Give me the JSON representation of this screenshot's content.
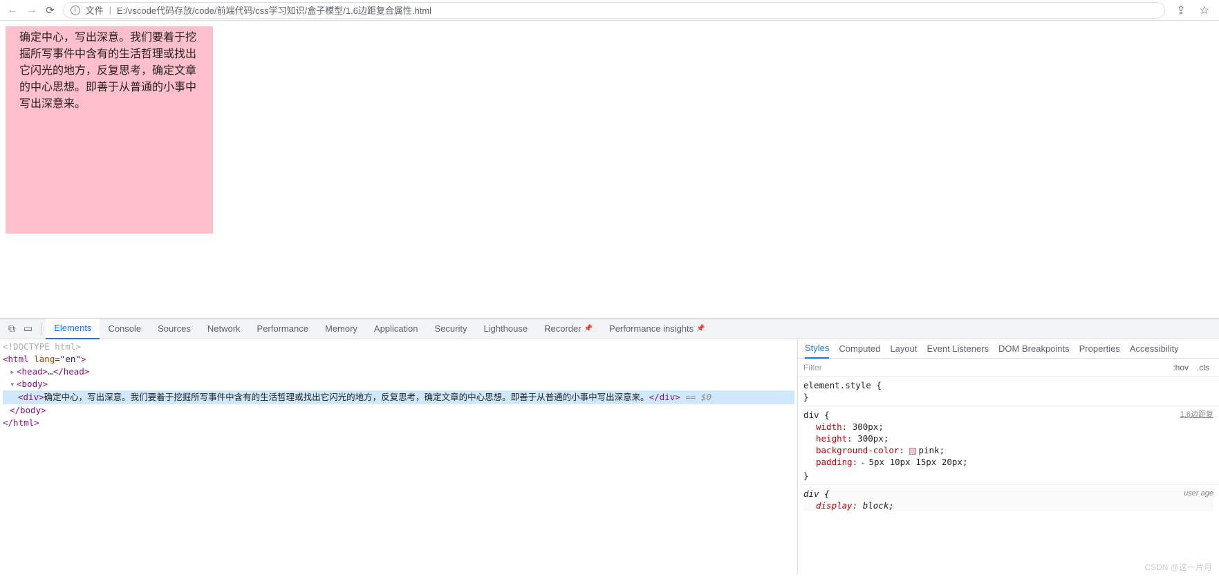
{
  "toolbar": {
    "file_label": "文件",
    "url": "E:/vscode代码存放/code/前端代码/css学习知识/盒子模型/1.6边距复合属性.html"
  },
  "page": {
    "box_text": "确定中心，写出深意。我们要着于挖掘所写事件中含有的生活哲理或找出它闪光的地方，反复思考，确定文章的中心思想。即善于从普通的小事中写出深意来。"
  },
  "devtools": {
    "tabs": [
      "Elements",
      "Console",
      "Sources",
      "Network",
      "Performance",
      "Memory",
      "Application",
      "Security",
      "Lighthouse",
      "Recorder",
      "Performance insights"
    ],
    "active_tab": "Elements"
  },
  "elements": {
    "doctype": "<!DOCTYPE html>",
    "html_open": "<html lang=\"en\">",
    "head_collapsed": "<head>…</head>",
    "body_open": "<body>",
    "div_text": "确定中心，写出深意。我们要着于挖掘所写事件中含有的生活哲理或找出它闪光的地方，反复思考，确定文章的中心思想。即善于从普通的小事中写出深意来。",
    "selected_marker": "== $0",
    "body_close": "</body>",
    "html_close": "</html>"
  },
  "styles": {
    "tabs": [
      "Styles",
      "Computed",
      "Layout",
      "Event Listeners",
      "DOM Breakpoints",
      "Properties",
      "Accessibility"
    ],
    "filter_placeholder": "Filter",
    "hov": ":hov",
    "cls": ".cls",
    "element_style": "element.style {",
    "brace_close": "}",
    "div_rule": {
      "selector": "div {",
      "source": "1.6边距复",
      "props": {
        "width": {
          "name": "width",
          "value": "300px;"
        },
        "height": {
          "name": "height",
          "value": "300px;"
        },
        "bg": {
          "name": "background-color",
          "value": "pink;"
        },
        "padding": {
          "name": "padding",
          "value": "5px 10px 15px 20px;"
        }
      }
    },
    "ua_rule": {
      "selector": "div {",
      "source": "user age",
      "display": {
        "name": "display",
        "value": "block;"
      }
    }
  },
  "watermark": "CSDN @这一片月"
}
